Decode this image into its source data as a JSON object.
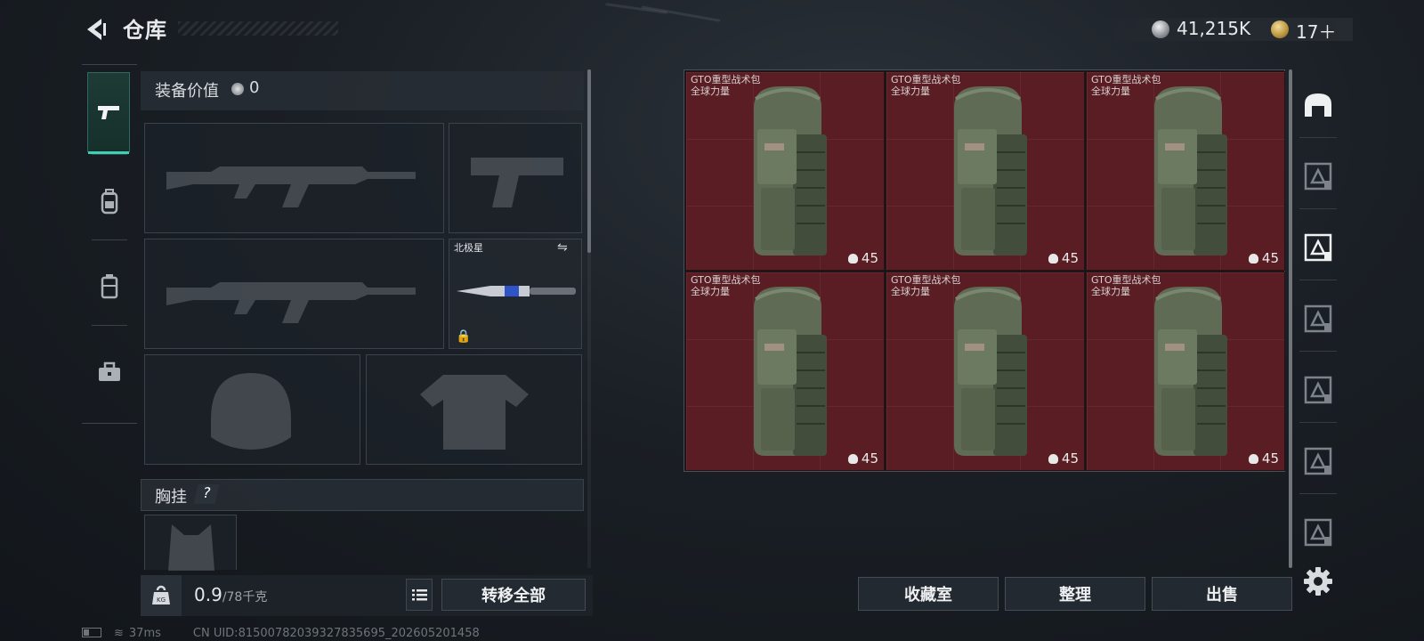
{
  "header": {
    "title": "仓库",
    "currencies": [
      {
        "icon": "silver-coin-icon",
        "value": "41,215K"
      },
      {
        "icon": "gold-coin-icon",
        "value": "17＋"
      }
    ]
  },
  "left_tabs": [
    {
      "icon": "pistol-icon",
      "selected": true
    },
    {
      "icon": "backpack-icon",
      "selected": false
    },
    {
      "icon": "chest-rig-icon",
      "selected": false
    },
    {
      "icon": "toolbox-icon",
      "selected": false
    }
  ],
  "equipment": {
    "value_label": "装备价值",
    "value": "0",
    "knife_name": "北极星",
    "vest_label": "胸挂",
    "vest_help": "?"
  },
  "bottom": {
    "weight": "0.9",
    "weight_max": "/78千克",
    "transfer_all": "转移全部"
  },
  "stash": {
    "items": [
      {
        "name": "GTO重型战术包",
        "tag": "全球力量",
        "count": "45"
      },
      {
        "name": "GTO重型战术包",
        "tag": "全球力量",
        "count": "45"
      },
      {
        "name": "GTO重型战术包",
        "tag": "全球力量",
        "count": "45"
      },
      {
        "name": "GTO重型战术包",
        "tag": "全球力量",
        "count": "45"
      },
      {
        "name": "GTO重型战术包",
        "tag": "全球力量",
        "count": "45"
      },
      {
        "name": "GTO重型战术包",
        "tag": "全球力量",
        "count": "45"
      }
    ],
    "buttons": {
      "collection": "收藏室",
      "sort": "整理",
      "sell": "出售"
    }
  },
  "right_tabs": [
    "stash-home-icon",
    "stash-page-1-icon",
    "stash-page-2-icon",
    "stash-page-3-icon",
    "stash-page-4-icon",
    "stash-page-5-icon",
    "stash-page-6-icon"
  ],
  "status_bar": {
    "ping": "37ms",
    "uid": "CN UID:815007820393278356​95_202605201458"
  },
  "colors": {
    "accent": "#3fd0b3",
    "item_bg": "#5a1d23"
  }
}
